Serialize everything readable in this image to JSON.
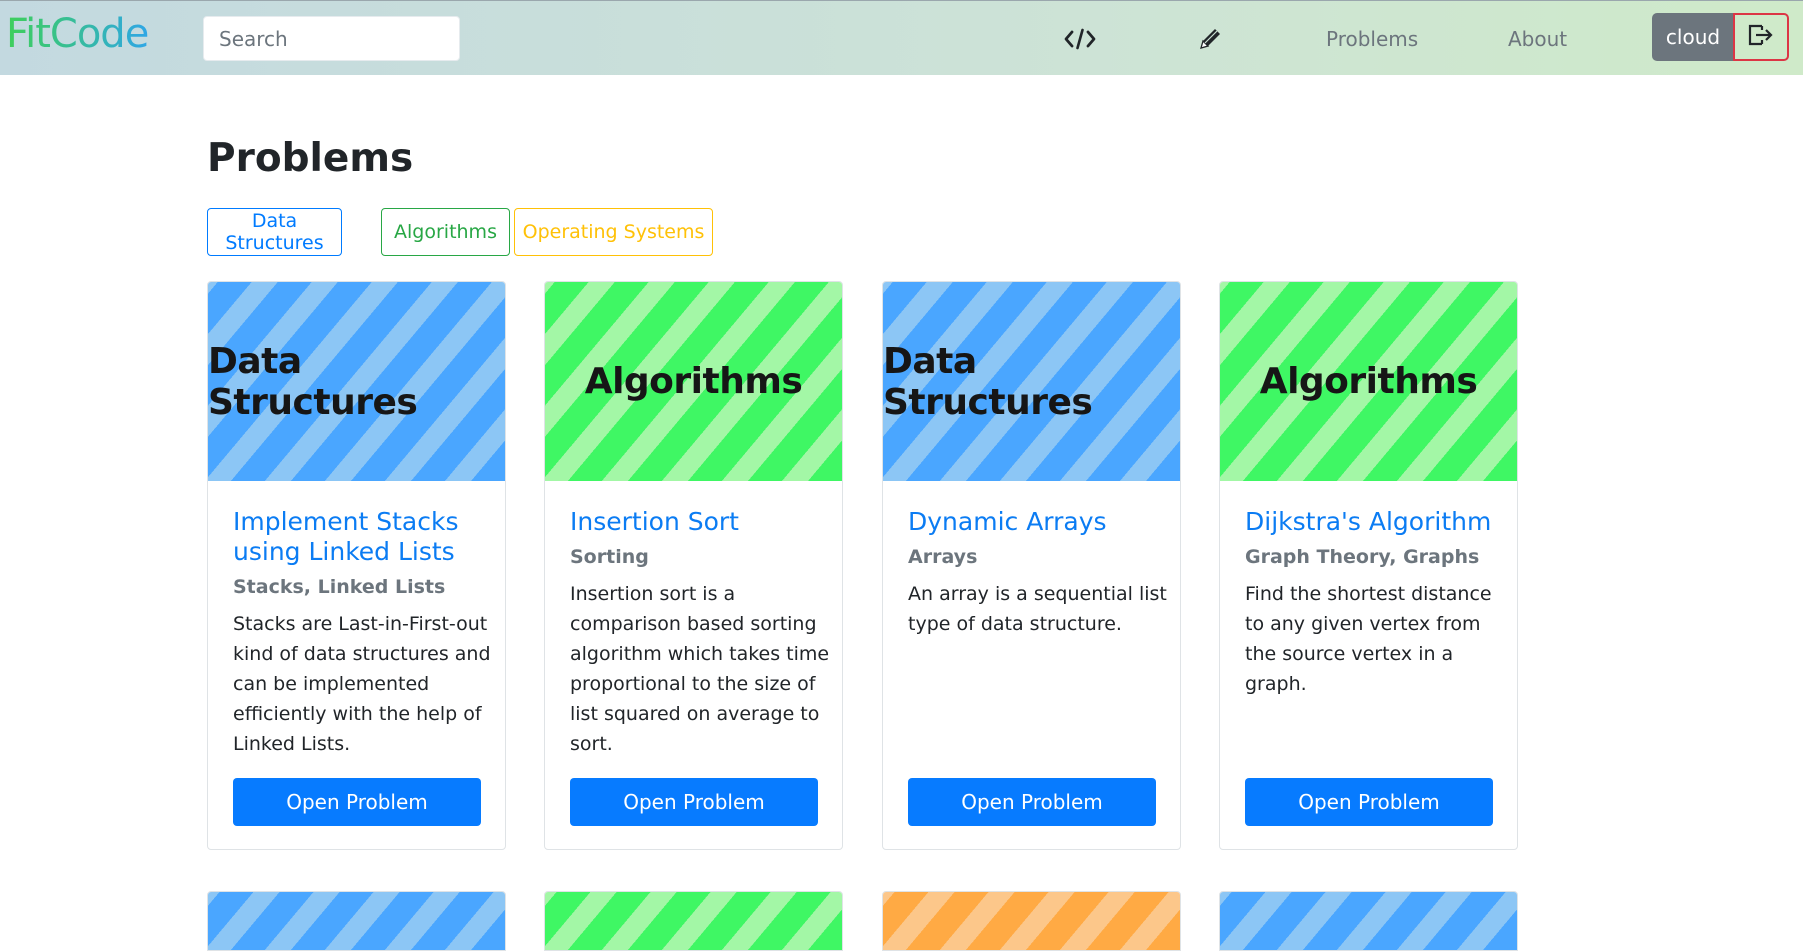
{
  "app": {
    "brand": "FitCode"
  },
  "navbar": {
    "search_placeholder": "Search",
    "code_icon": "code-icon",
    "edit_icon": "pencil-icon",
    "links": [
      "Problems",
      "About"
    ],
    "user": "cloud",
    "logout_icon": "logout-icon"
  },
  "page": {
    "title": "Problems",
    "filters": [
      {
        "label": "Data Structures",
        "color": "#007bff"
      },
      {
        "label": "Algorithms",
        "color": "#28a745"
      },
      {
        "label": "Operating Systems",
        "color": "#ffc107"
      }
    ]
  },
  "problems": [
    {
      "banner": "Data Structures",
      "banner_color": "blue",
      "title": "Implement Stacks using Linked Lists",
      "tags": "Stacks, Linked Lists",
      "description": "Stacks are Last-in-First-out kind of data structures and can be implemented efficiently with the help of Linked Lists.",
      "button": "Open Problem"
    },
    {
      "banner": "Algorithms",
      "banner_color": "green",
      "title": "Insertion Sort",
      "tags": "Sorting",
      "description": "Insertion sort is a comparison based sorting algorithm which takes time proportional to the size of list squared on average to sort.",
      "button": "Open Problem"
    },
    {
      "banner": "Data Structures",
      "banner_color": "blue",
      "title": "Dynamic Arrays",
      "tags": "Arrays",
      "description": "An array is a sequential list type of data structure.",
      "button": "Open Problem"
    },
    {
      "banner": "Algorithms",
      "banner_color": "green",
      "title": "Dijkstra's Algorithm",
      "tags": "Graph Theory, Graphs",
      "description": "Find the shortest distance to any given vertex from the source vertex in a graph.",
      "button": "Open Problem"
    }
  ],
  "next_row_banners": [
    "blue",
    "green",
    "orange",
    "blue"
  ]
}
